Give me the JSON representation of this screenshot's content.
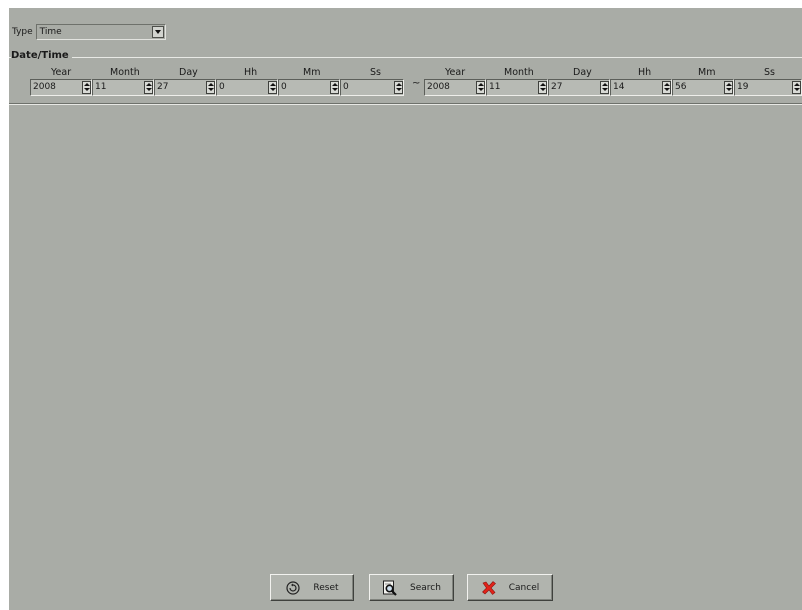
{
  "type_filter": {
    "label": "Type",
    "selected": "Time"
  },
  "datetime": {
    "title": "Date/Time",
    "range_separator": "~",
    "from": {
      "year_label": "Year",
      "year": "2008",
      "month_label": "Month",
      "month": "11",
      "day_label": "Day",
      "day": "27",
      "hour_label": "Hh",
      "hour": "0",
      "minute_label": "Mm",
      "minute": "0",
      "second_label": "Ss",
      "second": "0"
    },
    "to": {
      "year_label": "Year",
      "year": "2008",
      "month_label": "Month",
      "month": "11",
      "day_label": "Day",
      "day": "27",
      "hour_label": "Hh",
      "hour": "14",
      "minute_label": "Mm",
      "minute": "56",
      "second_label": "Ss",
      "second": "19"
    }
  },
  "buttons": {
    "reset": {
      "label": "Reset",
      "icon": "reset-icon"
    },
    "search": {
      "label": "Search",
      "icon": "search-document-icon"
    },
    "cancel": {
      "label": "Cancel",
      "icon": "cancel-x-icon"
    }
  },
  "colors": {
    "window_bg": "#a9aca6",
    "cancel_icon": "#e2231a"
  }
}
